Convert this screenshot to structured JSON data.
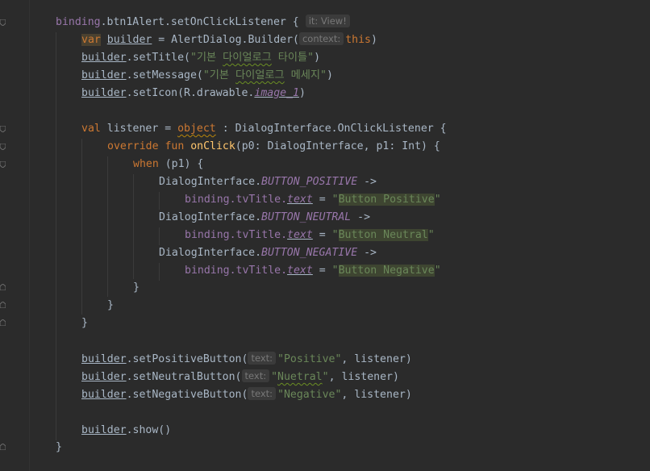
{
  "code": {
    "l1": {
      "obj": "binding",
      "mid": ".btn1Alert.",
      "fn": "setOnClickListener",
      "brace": " {",
      "hint": "it: View!"
    },
    "l2": {
      "kw": "var",
      "name": "builder",
      "eq": " = AlertDialog.Builder(",
      "hint": "context:",
      "arg": "this",
      "close": ")"
    },
    "l3": {
      "obj": "builder",
      "call": ".setTitle(",
      "str1": "\"기본 ",
      "str2": "다이얼로그",
      "str3": " 타이틀\"",
      "close": ")"
    },
    "l4": {
      "obj": "builder",
      "call": ".setMessage(",
      "str1": "\"기본 ",
      "str2": "다이얼로그",
      "str3": " 메세지\"",
      "close": ")"
    },
    "l5": {
      "obj": "builder",
      "call": ".setIcon(R.drawable.",
      "prop": "image_1",
      "close": ")"
    },
    "l6": {
      "kw": "val",
      "name": " listener = ",
      "obj": "object",
      "rest": " : DialogInterface.OnClickListener {"
    },
    "l7": {
      "kw": "override fun ",
      "fn": "onClick",
      "rest": "(p0: DialogInterface, p1: Int) {"
    },
    "l8": {
      "kw": "when",
      "rest": " (p1) {"
    },
    "l9": {
      "cls": "DialogInterface.",
      "prop": "BUTTON_POSITIVE",
      "arrow": " ->"
    },
    "l10": {
      "obj": "binding.tvTitle.",
      "prop": "text",
      "eq": " = ",
      "q1": "\"",
      "val": "Button Positive",
      "q2": "\""
    },
    "l11": {
      "cls": "DialogInterface.",
      "prop": "BUTTON_NEUTRAL",
      "arrow": " ->"
    },
    "l12": {
      "obj": "binding.tvTitle.",
      "prop": "text",
      "eq": " = ",
      "q1": "\"",
      "val": "Button Neutral",
      "q2": "\""
    },
    "l13": {
      "cls": "DialogInterface.",
      "prop": "BUTTON_NEGATIVE",
      "arrow": " ->"
    },
    "l14": {
      "obj": "binding.tvTitle.",
      "prop": "text",
      "eq": " = ",
      "q1": "\"",
      "val": "Button Negative",
      "q2": "\""
    },
    "l15": "}",
    "l16": "}",
    "l17": "}",
    "l18": {
      "obj": "builder",
      "call": ".setPositiveButton(",
      "hint": "text:",
      "str": "\"Positive\"",
      "rest": ", listener)"
    },
    "l19": {
      "obj": "builder",
      "call": ".setNeutralButton(",
      "hint": "text:",
      "str1": "\"",
      "str2": "Nuetral",
      "str3": "\"",
      "rest": ", listener)"
    },
    "l20": {
      "obj": "builder",
      "call": ".setNegativeButton(",
      "hint": "text:",
      "str": "\"Negative\"",
      "rest": ", listener)"
    },
    "l21": {
      "obj": "builder",
      "call": ".show()"
    },
    "l22": "}"
  },
  "gutter_icons": [
    "fold-icon",
    "fold-icon",
    "fold-icon",
    "fold-icon",
    "fold-icon",
    "fold-end-icon",
    "fold-end-icon",
    "fold-end-icon",
    "fold-end-icon"
  ]
}
